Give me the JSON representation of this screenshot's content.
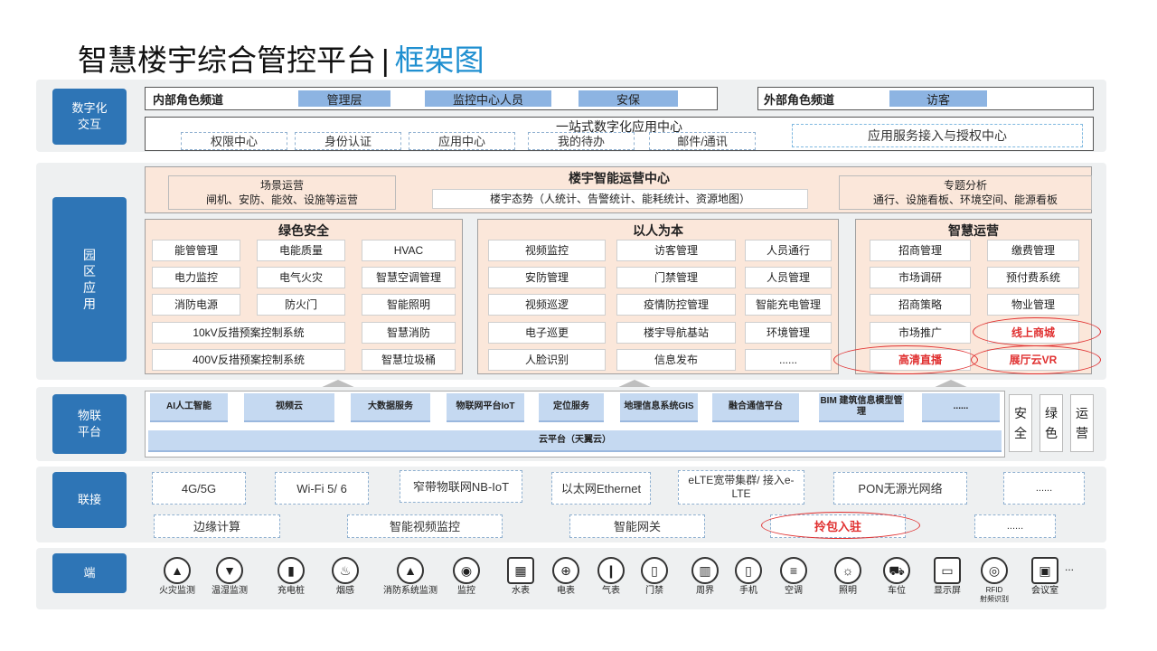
{
  "title": {
    "main": "智慧楼宇综合管控平台",
    "separator": "|",
    "sub": "框架图"
  },
  "layers": {
    "digital": "数字化\n交互",
    "park": "园\n区\n应\n用",
    "iot": "物联\n平台",
    "connect": "联接",
    "terminal": "端"
  },
  "digital": {
    "internal_label": "内部角色频道",
    "internal_roles": [
      "管理层",
      "监控中心人员",
      "安保"
    ],
    "external_label": "外部角色频道",
    "external_roles": [
      "访客"
    ],
    "center_title": "一站式数字化应用中心",
    "center_items": [
      "权限中心",
      "身份认证",
      "应用中心",
      "我的待办",
      "邮件/通讯"
    ],
    "auth_center": "应用服务接入与授权中心"
  },
  "ops_center": {
    "title": "楼宇智能运营中心",
    "scene_title": "场景运营",
    "scene_desc": "闸机、安防、能效、设施等运营",
    "situation": "楼宇态势（人统计、告警统计、能耗统计、资源地图）",
    "topic_title": "专题分析",
    "topic_desc": "通行、设施看板、环境空间、能源看板"
  },
  "green": {
    "title": "绿色安全",
    "rows": [
      [
        "能管管理",
        "电能质量",
        "HVAC"
      ],
      [
        "电力监控",
        "电气火灾",
        "智慧空调管理"
      ],
      [
        "消防电源",
        "防火门",
        "智能照明"
      ],
      [
        "10kV反措预案控制系统",
        "智慧消防"
      ],
      [
        "400V反措预案控制系统",
        "智慧垃圾桶"
      ]
    ]
  },
  "people": {
    "title": "以人为本",
    "rows": [
      [
        "视频监控",
        "访客管理",
        "人员通行"
      ],
      [
        "安防管理",
        "门禁管理",
        "人员管理"
      ],
      [
        "视频巡逻",
        "疫情防控管理",
        "智能充电管理"
      ],
      [
        "电子巡更",
        "楼宇导航基站",
        "环境管理"
      ],
      [
        "人脸识别",
        "信息发布",
        "......"
      ]
    ]
  },
  "smart": {
    "title": "智慧运营",
    "rows": [
      [
        "招商管理",
        "缴费管理"
      ],
      [
        "市场调研",
        "预付费系统"
      ],
      [
        "招商策略",
        "物业管理"
      ],
      [
        "市场推广",
        "线上商城"
      ],
      [
        "高清直播",
        "展厅云VR"
      ]
    ]
  },
  "iot": {
    "items": [
      "AI人工智能",
      "视频云",
      "大数据服务",
      "物联网平台IoT",
      "定位服务",
      "地理信息系统GIS",
      "融合通信平台",
      "BIM 建筑信息模型管理",
      "......"
    ],
    "cloud": "云平台（天翼云）",
    "side": [
      "安\n全",
      "绿\n色",
      "运\n营"
    ]
  },
  "connect": {
    "row1": [
      "4G/5G",
      "Wi-Fi 5/ 6",
      "窄带物联网NB-IoT",
      "以太网Ethernet",
      "eLTE宽带集群/ 接入e-LTE",
      "PON无源光网络",
      "......"
    ],
    "row2": [
      "边缘计算",
      "智能视频监控",
      "智能网关",
      "拎包入驻",
      "......"
    ]
  },
  "devices": [
    {
      "label": "火灾监测",
      "icon": "fire-alarm-icon",
      "g": "▲"
    },
    {
      "label": "温湿监测",
      "icon": "thermometer-icon",
      "g": "▼"
    },
    {
      "label": "充电桩",
      "icon": "charging-pile-icon",
      "g": "▮"
    },
    {
      "label": "烟感",
      "icon": "smoke-detector-icon",
      "g": "♨"
    },
    {
      "label": "消防系统监测",
      "icon": "fire-extinguisher-icon",
      "g": "▲"
    },
    {
      "label": "监控",
      "icon": "camera-icon",
      "g": "◉"
    },
    {
      "label": "水表",
      "icon": "water-meter-icon",
      "g": "▦"
    },
    {
      "label": "电表",
      "icon": "power-meter-icon",
      "g": "⊕"
    },
    {
      "label": "气表",
      "icon": "gas-meter-icon",
      "g": "❙"
    },
    {
      "label": "门禁",
      "icon": "access-control-icon",
      "g": "▯"
    },
    {
      "label": "周界",
      "icon": "perimeter-icon",
      "g": "▥"
    },
    {
      "label": "手机",
      "icon": "phone-icon",
      "g": "▯"
    },
    {
      "label": "空调",
      "icon": "air-conditioner-icon",
      "g": "≡"
    },
    {
      "label": "照明",
      "icon": "bulb-icon",
      "g": "☼"
    },
    {
      "label": "车位",
      "icon": "parking-icon",
      "g": "⛟"
    },
    {
      "label": "显示屏",
      "icon": "display-icon",
      "g": "▭"
    },
    {
      "label": "RFID\n射频识别",
      "icon": "rfid-icon",
      "g": "◎"
    },
    {
      "label": "会议室",
      "icon": "meeting-room-icon",
      "g": "▣"
    }
  ],
  "devices_more": "..."
}
